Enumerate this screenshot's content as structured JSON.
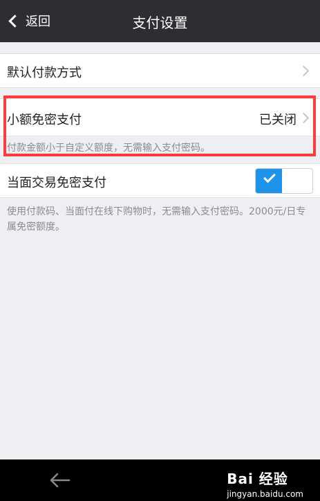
{
  "header": {
    "back_label": "返回",
    "title": "支付设置"
  },
  "settings": {
    "default_payment": {
      "label": "默认付款方式"
    },
    "small_amount_pay": {
      "label": "小额免密支付",
      "value": "已关闭",
      "hint": "付款金额小于自定义额度，无需输入支付密码。"
    },
    "face_to_face_pay": {
      "label": "当面交易免密支付",
      "enabled": true,
      "hint": "使用付款码、当面付在线下购物时，无需输入支付密码。2000元/日专属免密额度。"
    }
  },
  "colors": {
    "titlebar": "#2e2d31",
    "toggle_on": "#1f93ea",
    "highlight": "#ff3b3b"
  },
  "watermark": {
    "logo": "Bai 经验",
    "url": "jingyan.baidu.com"
  }
}
